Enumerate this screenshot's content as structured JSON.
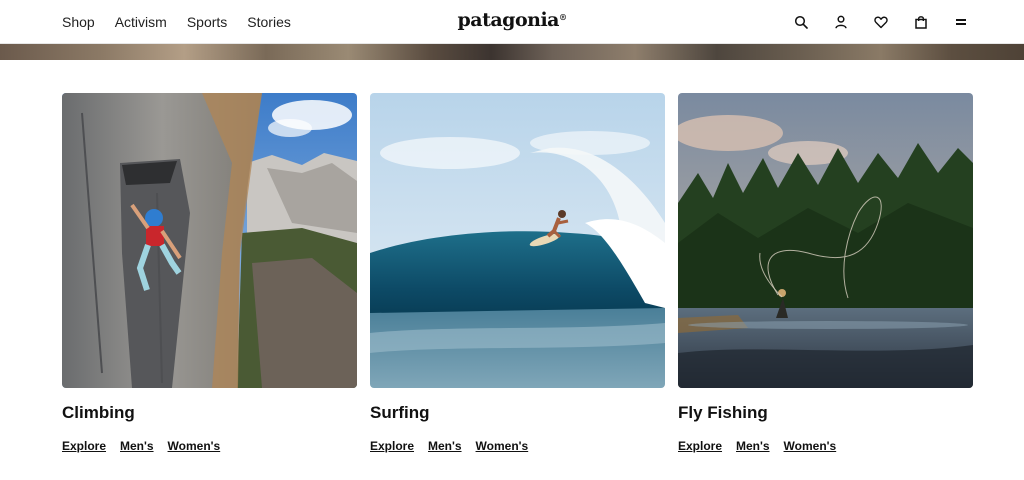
{
  "nav": {
    "links": [
      "Shop",
      "Activism",
      "Sports",
      "Stories"
    ],
    "brand": "patagonia",
    "brand_mark": "®",
    "icons": [
      "search-icon",
      "account-icon",
      "wishlist-heart-icon",
      "shopping-bag-icon",
      "menu-icon"
    ]
  },
  "cards": [
    {
      "title": "Climbing",
      "links": [
        "Explore",
        "Men's",
        "Women's"
      ]
    },
    {
      "title": "Surfing",
      "links": [
        "Explore",
        "Men's",
        "Women's"
      ]
    },
    {
      "title": "Fly Fishing",
      "links": [
        "Explore",
        "Men's",
        "Women's"
      ]
    }
  ],
  "colors": {
    "text": "#111111",
    "background": "#ffffff"
  }
}
